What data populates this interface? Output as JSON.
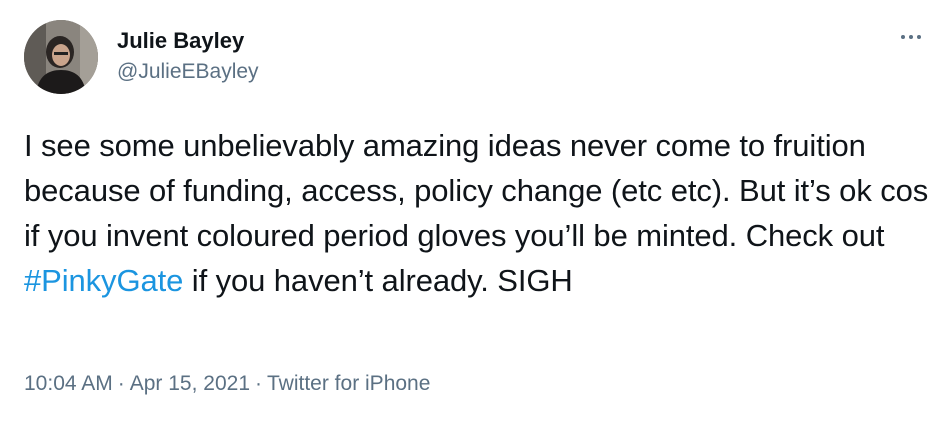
{
  "author": {
    "display_name": "Julie Bayley",
    "handle": "@JulieEBayley"
  },
  "more_icon": "more-horizontal-icon",
  "tweet": {
    "text_before": "I see some unbelievably amazing ideas never come to fruition because of funding, access, policy change (etc etc). But it’s ok cos if you invent coloured period gloves you’ll be minted. Check out ",
    "hashtag": "#PinkyGate",
    "text_after": " if you haven’t already. SIGH"
  },
  "meta": {
    "time": "10:04 AM",
    "separator": "·",
    "date": "Apr 15, 2021",
    "source": "Twitter for iPhone"
  },
  "colors": {
    "hashtag": "#1b95e0",
    "secondary_text": "#5b7083",
    "primary_text": "#0f1419"
  }
}
